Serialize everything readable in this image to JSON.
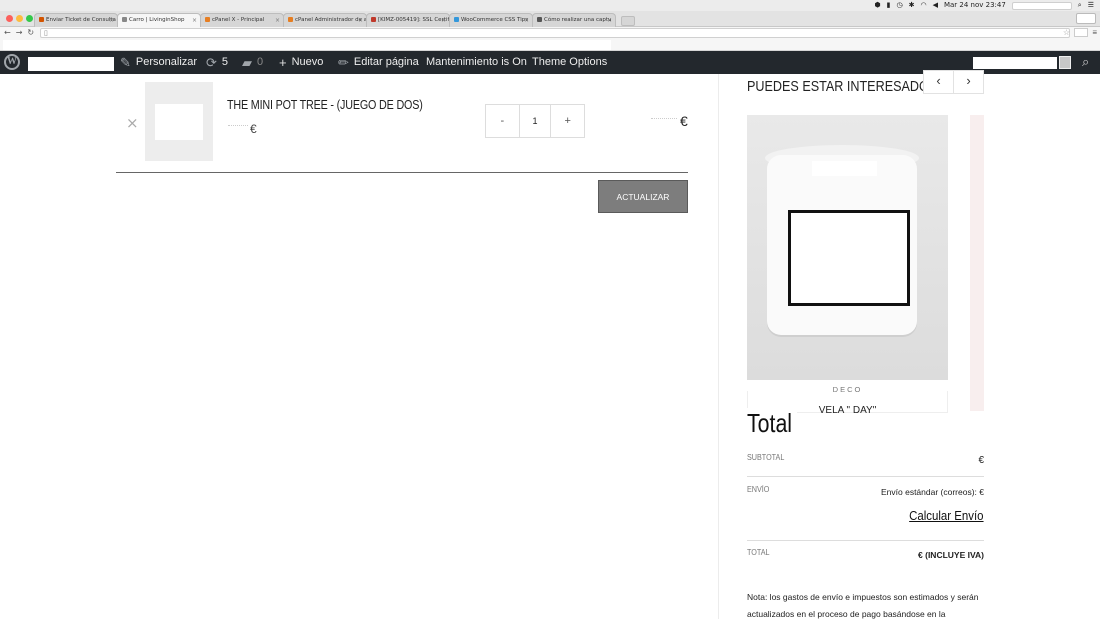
{
  "os_menubar": {
    "datetime": "Mar 24 nov  23:47"
  },
  "browser": {
    "tabs": [
      {
        "label": "Enviar Ticket de Consulta",
        "favicon_color": "#d35400"
      },
      {
        "label": "Carro | LivinginShop",
        "favicon_color": "#888888"
      },
      {
        "label": "cPanel X - Principal",
        "favicon_color": "#e67e22"
      },
      {
        "label": "cPanel Administrador de a",
        "favicon_color": "#e67e22"
      },
      {
        "label": "[KIMZ-005419]: SSL Certif",
        "favicon_color": "#c0392b"
      },
      {
        "label": "WooCommerce CSS Tips",
        "favicon_color": "#3498db"
      },
      {
        "label": "Cómo realizar una captu",
        "favicon_color": "#555555"
      }
    ],
    "active_tab_index": 1
  },
  "adminbar": {
    "customize": "Personalizar",
    "updates_count": "5",
    "comments_count": "0",
    "new": "Nuevo",
    "edit_page": "Editar página",
    "maintenance": "Mantenimiento is On",
    "theme_options": "Theme Options"
  },
  "cart": {
    "item": {
      "name": "THE MINI POT TREE - (JUEGO DE DOS)",
      "price_suffix": "€",
      "quantity": "1",
      "line_total_suffix": "€"
    },
    "qty_minus": "-",
    "qty_plus": "+",
    "update_button": "ACTUALIZAR CARRITO"
  },
  "related": {
    "title": "PUEDES ESTAR INTERESADO EN…",
    "prev": "‹",
    "next": "›",
    "product": {
      "category": "DECO",
      "name": "VELA \"           DAY\""
    }
  },
  "totals": {
    "title": "Total",
    "subtotal_label": "SUBTOTAL",
    "subtotal_value": "€",
    "shipping_label": "ENVÍO",
    "shipping_value": "Envío estándar (correos):     €",
    "calc_shipping": "Calcular Envío",
    "total_label": "TOTAL",
    "total_value": "€ (INCLUYE          IVA)",
    "note": "Nota: los gastos de envío e impuestos son estimados y serán actualizados en el proceso de pago basándose en la"
  }
}
